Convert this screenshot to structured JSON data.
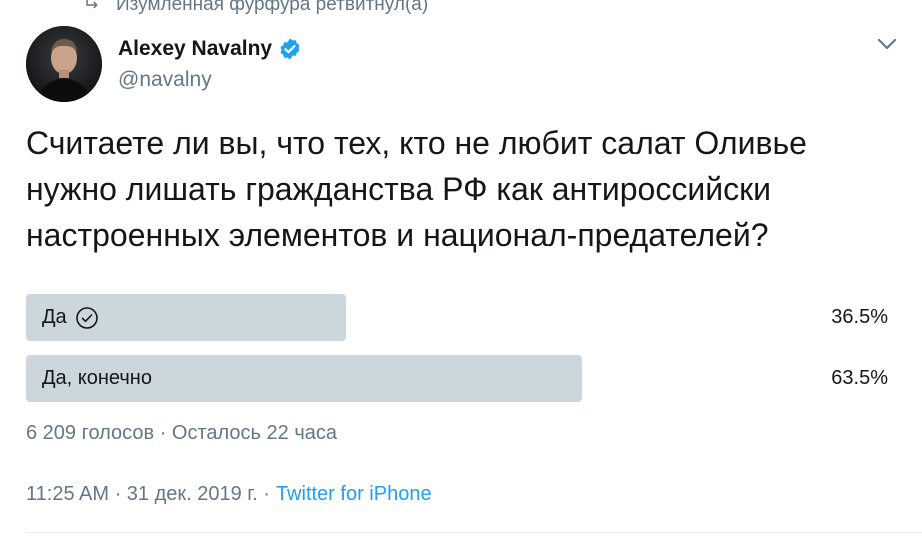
{
  "retweet": {
    "text": "Изумленная фурфура ретвитнул(а)",
    "icon": "retweet-icon"
  },
  "author": {
    "name": "Alexey Navalny",
    "handle": "@navalny",
    "verified": true,
    "verified_icon": "verified-badge-icon",
    "verified_color": "#1da1f2"
  },
  "tweet": {
    "lines": [
      "Считаете ли вы, что тех, кто не любит салат Оливье",
      "нужно лишать гражданства РФ как антироссийски",
      "настроенных элементов и национал-предателей?"
    ]
  },
  "poll": {
    "options": [
      {
        "label": "Да",
        "percent": "36.5%",
        "value": 36.5,
        "selected": true
      },
      {
        "label": "Да, конечно",
        "percent": "63.5%",
        "value": 63.5,
        "selected": false
      }
    ],
    "bar_color": "#ccd6dd",
    "meta": "6 209 голосов · Осталось 22 часа"
  },
  "footer": {
    "time": "11:25 AM · 31 дек. 2019 г. ·",
    "source": "Twitter for iPhone",
    "source_color": "#1da1f2"
  },
  "menu": {
    "icon": "chevron-down-icon"
  }
}
